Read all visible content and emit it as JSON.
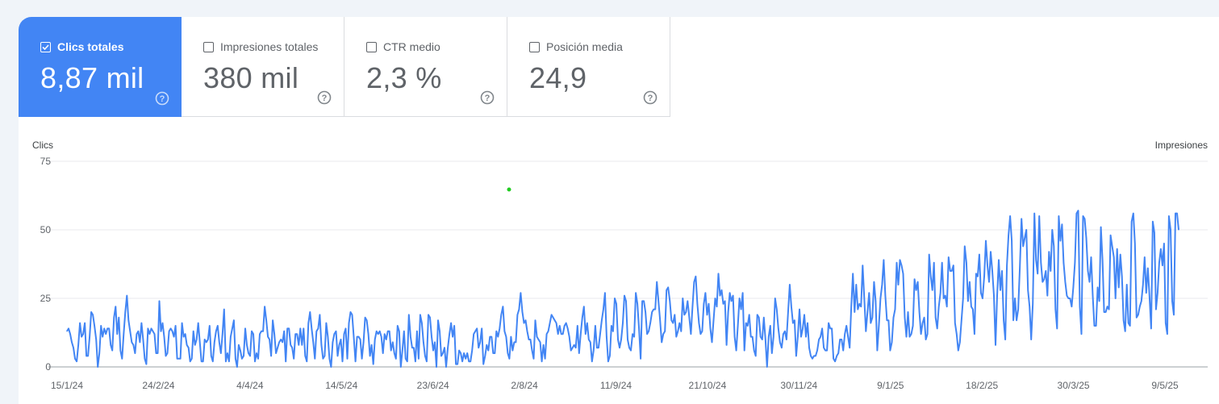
{
  "metrics": [
    {
      "label": "Clics totales",
      "value": "8,87 mil",
      "checked": true
    },
    {
      "label": "Impresiones totales",
      "value": "380 mil",
      "checked": false
    },
    {
      "label": "CTR medio",
      "value": "2,3 %",
      "checked": false
    },
    {
      "label": "Posición media",
      "value": "24,9",
      "checked": false
    }
  ],
  "colors": {
    "accent": "#4285f4",
    "line": "#4285f4",
    "grid": "#e8eaed",
    "dot": "#22cc22"
  },
  "chart_data": {
    "type": "line",
    "ylabel_left": "Clics",
    "ylabel_right": "Impresiones",
    "ylim": [
      0,
      75
    ],
    "yticks": [
      "0",
      "25",
      "50",
      "75"
    ],
    "xticks": [
      "15/1/24",
      "24/2/24",
      "4/4/24",
      "14/5/24",
      "23/6/24",
      "2/8/24",
      "11/9/24",
      "21/10/24",
      "30/11/24",
      "9/1/25",
      "18/2/25",
      "30/3/25",
      "9/5/25"
    ],
    "x_start": "15/1/24",
    "x_end": "12/5/25",
    "series": [
      {
        "values": [
          13,
          14,
          12,
          9,
          7,
          3,
          2,
          8,
          16,
          11,
          12,
          16,
          4,
          4,
          11,
          20,
          19,
          15,
          10,
          0,
          5,
          15,
          11,
          14,
          12,
          14,
          14,
          8,
          6,
          18,
          22,
          12,
          18,
          6,
          3,
          12,
          20,
          26,
          17,
          13,
          9,
          8,
          5,
          12,
          13,
          9,
          16,
          10,
          3,
          1,
          14,
          12,
          14,
          13,
          12,
          5,
          5,
          24,
          13,
          16,
          11,
          4,
          5,
          13,
          14,
          13,
          11,
          15,
          3,
          3,
          3,
          16,
          11,
          12,
          8,
          7,
          2,
          3,
          13,
          8,
          10,
          16,
          9,
          2,
          2,
          10,
          9,
          10,
          15,
          4,
          2,
          9,
          13,
          15,
          9,
          5,
          12,
          21,
          2,
          5,
          2,
          11,
          14,
          17,
          3,
          0,
          8,
          6,
          3,
          4,
          14,
          8,
          5,
          4,
          13,
          12,
          2,
          5,
          3,
          12,
          13,
          13,
          22,
          17,
          11,
          10,
          4,
          17,
          12,
          5,
          7,
          9,
          10,
          9,
          13,
          2,
          14,
          14,
          8,
          7,
          3,
          12,
          12,
          8,
          14,
          8,
          14,
          4,
          2,
          16,
          20,
          14,
          9,
          3,
          13,
          14,
          19,
          8,
          3,
          4,
          16,
          11,
          3,
          0,
          9,
          12,
          13,
          4,
          8,
          10,
          2,
          12,
          14,
          3,
          16,
          20,
          19,
          11,
          2,
          11,
          11,
          10,
          3,
          9,
          18,
          17,
          12,
          4,
          8,
          1,
          10,
          13,
          12,
          13,
          11,
          5,
          12,
          10,
          13,
          13,
          6,
          9,
          5,
          3,
          15,
          13,
          0,
          6,
          13,
          3,
          2,
          19,
          11,
          7,
          7,
          2,
          13,
          3,
          19,
          16,
          9,
          4,
          2,
          19,
          18,
          11,
          6,
          9,
          0,
          17,
          13,
          4,
          5,
          7,
          0,
          7,
          12,
          16,
          11,
          15,
          1,
          1,
          6,
          5,
          2,
          5,
          3,
          5,
          2,
          2,
          6,
          12,
          13,
          14,
          7,
          9,
          14,
          1,
          4,
          8,
          6,
          11,
          11,
          5,
          5,
          13,
          11,
          14,
          19,
          22,
          13,
          11,
          5,
          3,
          11,
          6,
          9,
          9,
          19,
          21,
          27,
          20,
          16,
          17,
          13,
          10,
          10,
          6,
          3,
          17,
          11,
          10,
          9,
          2,
          8,
          3,
          12,
          13,
          16,
          19,
          18,
          17,
          16,
          12,
          15,
          12,
          12,
          15,
          16,
          14,
          11,
          6,
          7,
          8,
          7,
          15,
          5,
          12,
          18,
          22,
          12,
          16,
          10,
          9,
          2,
          6,
          15,
          7,
          7,
          12,
          17,
          21,
          27,
          11,
          2,
          4,
          15,
          13,
          25,
          23,
          10,
          7,
          10,
          16,
          26,
          24,
          10,
          7,
          6,
          12,
          11,
          27,
          23,
          14,
          3,
          24,
          24,
          20,
          12,
          13,
          16,
          20,
          21,
          21,
          31,
          24,
          17,
          9,
          12,
          13,
          28,
          29,
          24,
          17,
          16,
          19,
          11,
          13,
          16,
          13,
          25,
          19,
          20,
          24,
          18,
          12,
          22,
          31,
          33,
          23,
          16,
          12,
          13,
          23,
          27,
          19,
          23,
          14,
          9,
          17,
          25,
          22,
          34,
          26,
          28,
          23,
          24,
          8,
          20,
          27,
          24,
          26,
          11,
          6,
          15,
          25,
          21,
          27,
          6,
          16,
          15,
          19,
          11,
          11,
          6,
          4,
          19,
          18,
          11,
          10,
          18,
          10,
          0,
          11,
          15,
          5,
          11,
          25,
          21,
          14,
          9,
          7,
          12,
          13,
          10,
          20,
          30,
          22,
          16,
          17,
          4,
          11,
          21,
          11,
          14,
          19,
          11,
          16,
          7,
          4,
          3,
          4,
          4,
          6,
          10,
          11,
          14,
          7,
          6,
          6,
          16,
          14,
          14,
          3,
          2,
          4,
          5,
          10,
          10,
          6,
          12,
          15,
          11,
          7,
          22,
          34,
          20,
          30,
          21,
          23,
          22,
          37,
          25,
          13,
          20,
          27,
          16,
          18,
          31,
          24,
          6,
          15,
          25,
          30,
          39,
          26,
          17,
          17,
          6,
          9,
          18,
          21,
          38,
          30,
          39,
          37,
          34,
          18,
          11,
          20,
          11,
          12,
          15,
          32,
          28,
          31,
          20,
          12,
          16,
          18,
          10,
          12,
          41,
          33,
          28,
          38,
          18,
          14,
          22,
          27,
          38,
          25,
          26,
          22,
          40,
          35,
          35,
          37,
          16,
          12,
          6,
          9,
          17,
          25,
          44,
          38,
          24,
          31,
          22,
          21,
          12,
          34,
          33,
          41,
          27,
          25,
          33,
          46,
          37,
          31,
          42,
          35,
          26,
          8,
          26,
          39,
          28,
          35,
          17,
          10,
          37,
          48,
          55,
          46,
          17,
          25,
          17,
          21,
          36,
          54,
          44,
          47,
          50,
          28,
          22,
          10,
          23,
          56,
          39,
          34,
          55,
          38,
          31,
          32,
          35,
          26,
          42,
          35,
          50,
          44,
          21,
          14,
          55,
          46,
          52,
          38,
          31,
          26,
          25,
          25,
          22,
          29,
          38,
          56,
          57,
          22,
          12,
          55,
          54,
          47,
          35,
          31,
          40,
          26,
          15,
          15,
          29,
          24,
          51,
          39,
          20,
          20,
          22,
          21,
          48,
          44,
          40,
          25,
          43,
          29,
          41,
          33,
          17,
          13,
          30,
          16,
          15,
          53,
          56,
          45,
          18,
          19,
          22,
          24,
          30,
          40,
          27,
          36,
          26,
          14,
          53,
          49,
          21,
          27,
          38,
          43,
          37,
          45,
          16,
          12,
          55,
          50,
          24,
          19,
          56,
          56,
          50
        ]
      }
    ]
  }
}
